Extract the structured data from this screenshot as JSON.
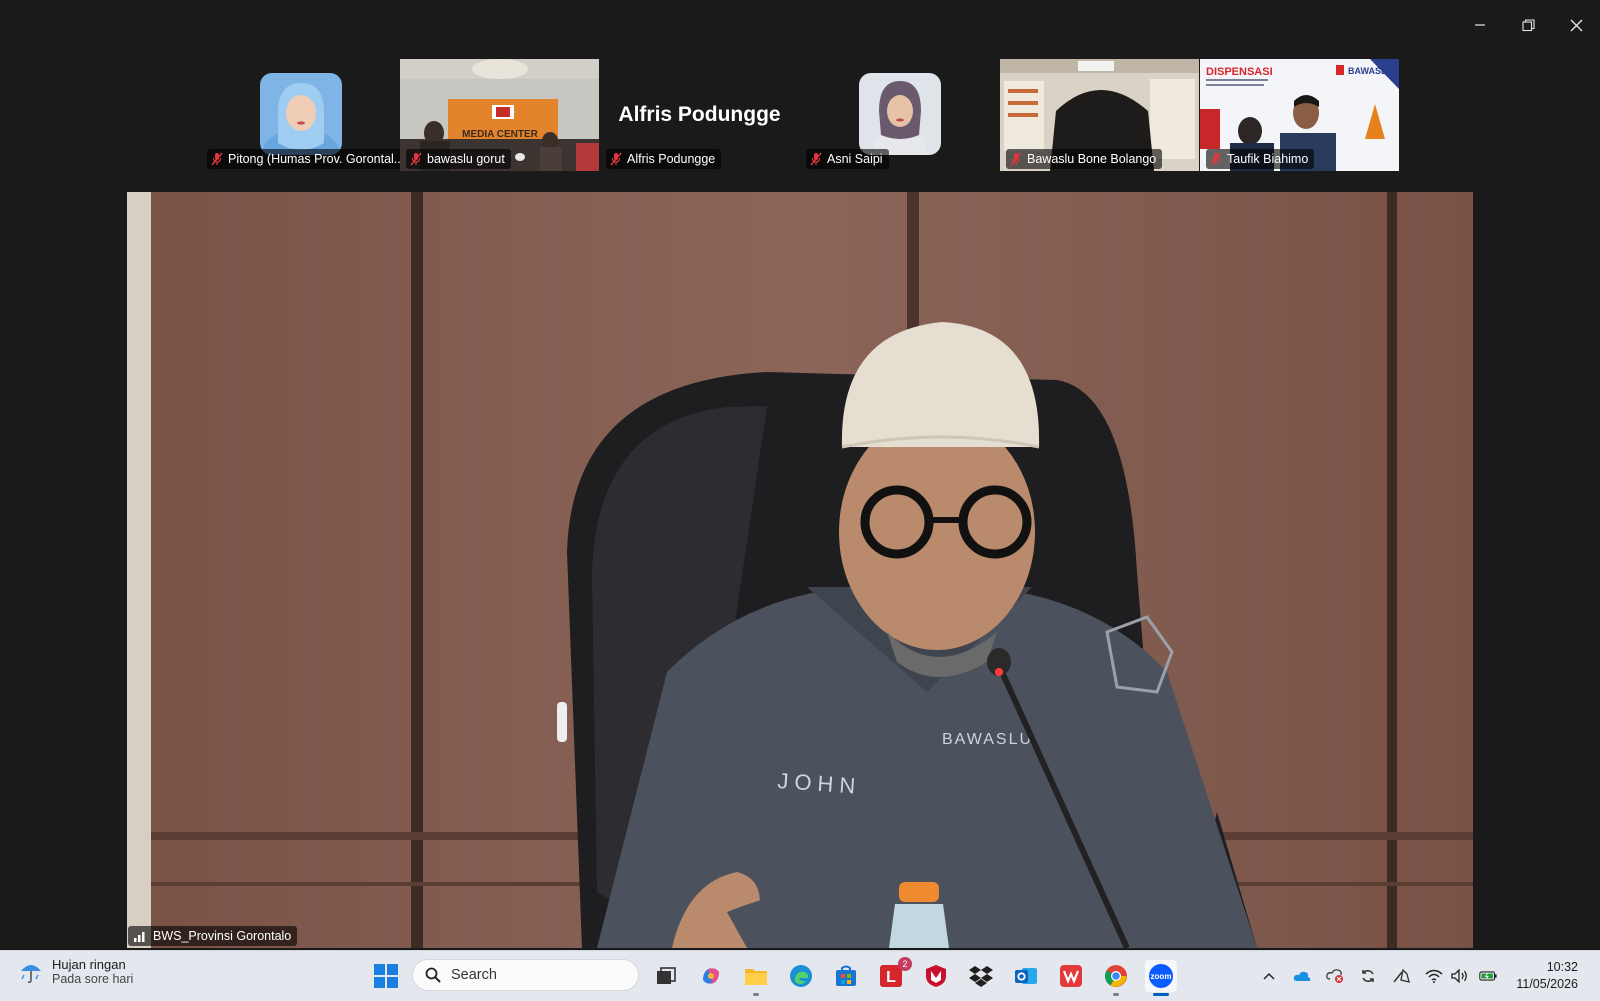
{
  "window": {
    "controls": [
      "minimize",
      "restore",
      "close"
    ]
  },
  "participants": [
    {
      "name": "Pitong (Humas Prov. Gorontal...",
      "muted": true,
      "type": "avatar"
    },
    {
      "name": "bawaslu gorut",
      "muted": true,
      "type": "video"
    },
    {
      "name": "Alfris Podungge",
      "display_name": "Alfris Podungge",
      "muted": true,
      "type": "name-only"
    },
    {
      "name": "Asni Saipi",
      "muted": true,
      "type": "avatar"
    },
    {
      "name": "Bawaslu Bone Bolango",
      "muted": true,
      "type": "video"
    },
    {
      "name": "Taufik Biahimo",
      "muted": true,
      "type": "video"
    }
  ],
  "video_signs": {
    "media_center": "MEDIA CENTER",
    "dispensasi": "DISPENSASI",
    "bawaslu": "BAWASLU"
  },
  "main_speaker": {
    "name": "BWS_Provinsi Gorontalo",
    "uniform_name": "JOHN",
    "uniform_org": "BAWASLU"
  },
  "taskbar": {
    "weather": {
      "title": "Hujan ringan",
      "subtitle": "Pada sore hari"
    },
    "search_placeholder": "Search",
    "apps": [
      {
        "name": "task-view",
        "running": false
      },
      {
        "name": "copilot",
        "running": false
      },
      {
        "name": "file-explorer",
        "running": true
      },
      {
        "name": "edge",
        "running": false
      },
      {
        "name": "microsoft-store",
        "running": false
      },
      {
        "name": "lark",
        "running": false,
        "badge": "2"
      },
      {
        "name": "mcafee",
        "running": false
      },
      {
        "name": "dropbox",
        "running": false
      },
      {
        "name": "outlook",
        "running": false
      },
      {
        "name": "wps",
        "running": false
      },
      {
        "name": "chrome",
        "running": true
      },
      {
        "name": "zoom",
        "running": true,
        "active": true
      }
    ],
    "clock": {
      "time": "10:32",
      "date": "11/05/2026"
    }
  },
  "colors": {
    "background": "#1a1a1a",
    "taskbar": "#e4e8ee",
    "zoom_blue": "#0b5cff",
    "muted_red": "#e0383e"
  }
}
